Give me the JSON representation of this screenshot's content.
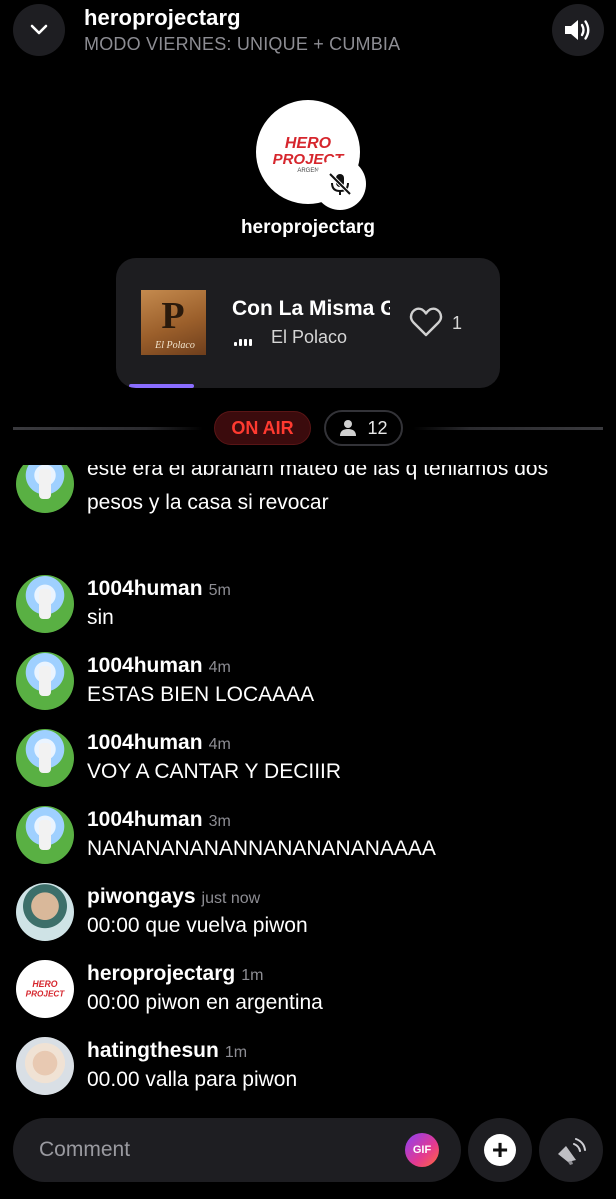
{
  "header": {
    "title": "heroprojectarg",
    "subtitle": "MODO VIERNES: UNIQUE + CUMBIA",
    "collapse_icon": "chevron-down-icon",
    "speaker_icon": "speaker-icon"
  },
  "host": {
    "name": "heroprojectarg",
    "logo_text": "HERO PROJECT",
    "logo_sub": "ARGEN",
    "mic_icon": "mic-muted-icon"
  },
  "now_playing": {
    "title": "Con La Misma Ganas",
    "artist": "El Polaco",
    "art_letter": "P",
    "art_label": "El Polaco",
    "likes": "1",
    "progress_fraction": 0.17
  },
  "status": {
    "on_air": "ON AIR",
    "listeners": "12"
  },
  "messages": [
    {
      "user": "1004human",
      "time": "5m",
      "text": "este era el abraham mateo de las q teniamos dos pesos y la casa si revocar",
      "avatar": "human"
    },
    {
      "user": "1004human",
      "time": "5m",
      "text": "sin",
      "avatar": "human"
    },
    {
      "user": "1004human",
      "time": "4m",
      "text": "ESTAS BIEN LOCAAAA",
      "avatar": "human"
    },
    {
      "user": "1004human",
      "time": "4m",
      "text": "VOY A CANTAR Y DECIIIR",
      "avatar": "human"
    },
    {
      "user": "1004human",
      "time": "3m",
      "text": "NANANANANANNANANANANAAAA",
      "avatar": "human"
    },
    {
      "user": "piwongays",
      "time": "just now",
      "text": "00:00 que vuelva piwon",
      "avatar": "piwon"
    },
    {
      "user": "heroprojectarg",
      "time": "1m",
      "text": "00:00 piwon en argentina",
      "avatar": "hero"
    },
    {
      "user": "hatingthesun",
      "time": "1m",
      "text": "00.00 valla para piwon",
      "avatar": "sun"
    }
  ],
  "composer": {
    "placeholder": "Comment",
    "gif_label": "GIF",
    "plus_icon": "plus-icon",
    "broadcast_icon": "broadcast-speaker-icon"
  },
  "colors": {
    "background": "#000000",
    "on_air_red": "#ff3a30",
    "progress": "#8a6dff",
    "card": "#1d1d20"
  }
}
